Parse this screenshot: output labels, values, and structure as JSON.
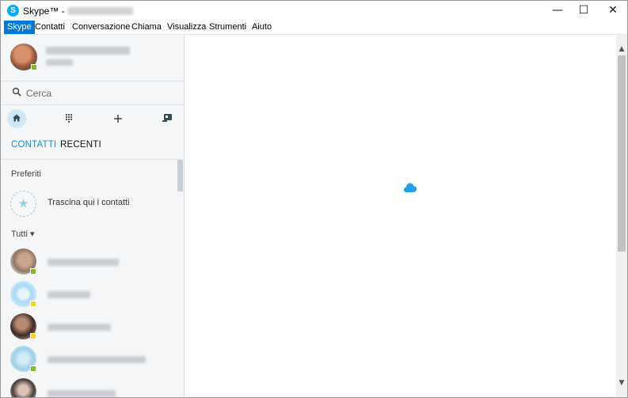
{
  "window": {
    "title": "Skype™ -",
    "min_glyph": "—",
    "max_glyph": "☐",
    "close_glyph": "✕"
  },
  "menu": [
    {
      "label": "Skype",
      "active": true
    },
    {
      "label": "Contatti"
    },
    {
      "label": "Conversazione"
    },
    {
      "label": "Chiama"
    },
    {
      "label": "Visualizza"
    },
    {
      "label": "Strumenti"
    },
    {
      "label": "Aiuto"
    }
  ],
  "search": {
    "placeholder": "Cerca"
  },
  "toolbar": {
    "home_icon": "home-icon",
    "dialpad_icon": "dialpad-icon",
    "add_icon": "add-icon",
    "contact_card_icon": "contact-card-icon"
  },
  "tabs": {
    "contatti": "CONTATTI",
    "recenti": "RECENTI"
  },
  "favorites": {
    "label": "Preferiti",
    "drop_hint": "Trascina qui i contatti"
  },
  "all": {
    "label": "Tutti ▾"
  },
  "colors": {
    "accent": "#00aff0",
    "menu_active": "#0078d7",
    "tab_active": "#0c8fd1",
    "online": "#7cbb2f",
    "away": "#f8d21c"
  }
}
